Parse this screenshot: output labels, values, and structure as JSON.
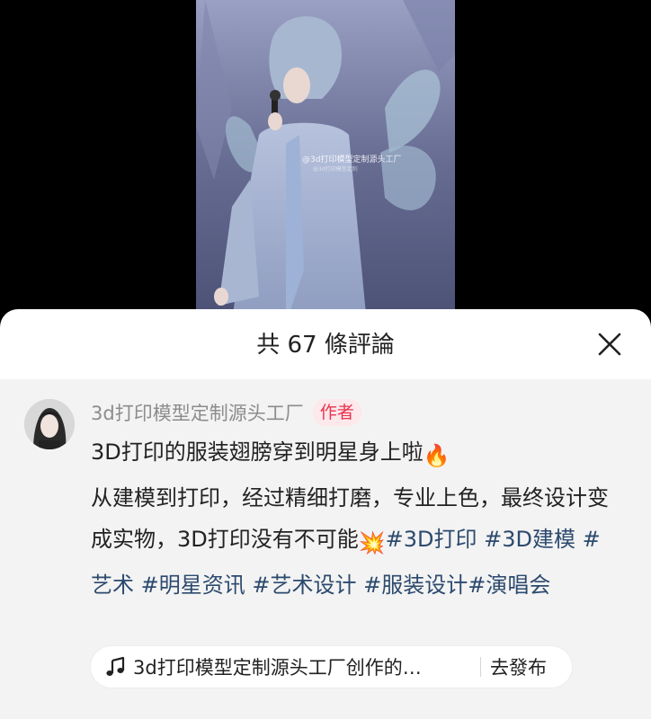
{
  "video": {
    "watermark": "@3d打印模型定制源头工厂",
    "watermark_sub": "@3d打印模型定制"
  },
  "sheet": {
    "title": "共 67 條評論",
    "close_icon": "close-x-icon"
  },
  "comment": {
    "author": "3d打印模型定制源头工厂",
    "badge": "作者",
    "text_line1": "3D打印的服装翅膀穿到明星身上啦",
    "emoji_fire": "🔥",
    "text_body": "从建模到打印，经过精细打磨，专业上色，最终设计变成实物，3D打印没有不可能",
    "emoji_explosion": "💥",
    "hashtags": [
      "#3D打印",
      "#3D建模",
      "#艺术",
      "#明星资讯",
      "#艺术设计",
      "#服装设计",
      "#演唱会"
    ]
  },
  "music": {
    "icon": "music-note-icon",
    "text": "3d打印模型定制源头工厂创作的…",
    "action": "去發布"
  },
  "colors": {
    "hashtag": "#2c4a6e",
    "badge_text": "#e8344e",
    "badge_bg": "#fde8ec",
    "sheet_bg": "#ffffff",
    "comment_bg": "#f3f3f3"
  }
}
